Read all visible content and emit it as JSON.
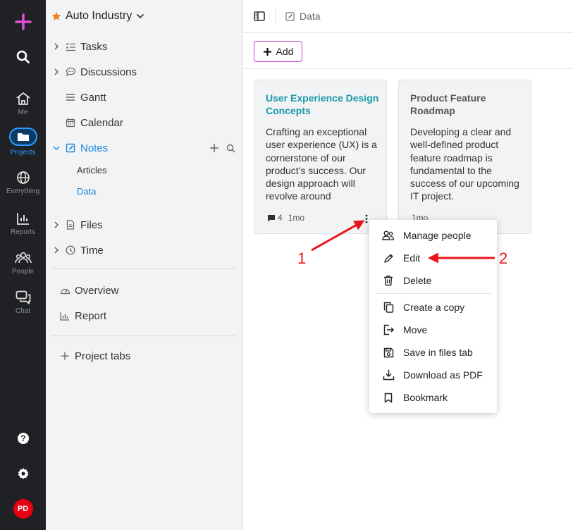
{
  "rail": {
    "items": [
      {
        "icon": "home-icon",
        "label": "Me"
      },
      {
        "icon": "folder-icon",
        "label": "Projects"
      },
      {
        "icon": "globe-icon",
        "label": "Everything"
      },
      {
        "icon": "chart-icon",
        "label": "Reports"
      },
      {
        "icon": "people-icon",
        "label": "People"
      },
      {
        "icon": "chat-icon",
        "label": "Chat"
      }
    ],
    "avatar": "PD",
    "accent": "#2f9bff",
    "add_color": "#e04fd6"
  },
  "sidebar": {
    "project": "Auto Industry",
    "nav": [
      {
        "label": "Tasks"
      },
      {
        "label": "Discussions"
      },
      {
        "label": "Gantt"
      },
      {
        "label": "Calendar"
      },
      {
        "label": "Notes"
      },
      {
        "label": "Files"
      },
      {
        "label": "Time"
      }
    ],
    "notes_sub": [
      {
        "label": "Articles"
      },
      {
        "label": "Data"
      }
    ],
    "extra": [
      {
        "label": "Overview"
      },
      {
        "label": "Report"
      }
    ],
    "project_tabs": "Project tabs"
  },
  "main": {
    "breadcrumb": "Data",
    "add_label": "Add",
    "cards": [
      {
        "title": "User Experience Design Concepts",
        "body": "Crafting an exceptional user experience (UX) is a cornerstone of our product's success. Our design approach will revolve around",
        "comments": "4",
        "age": "1mo",
        "title_color": "#1a9aa8"
      },
      {
        "title": "Product Feature Roadmap",
        "body": "Developing a clear and well-defined product feature roadmap is fundamental to the success of our upcoming IT project.",
        "age": "1mo",
        "title_color": "#555555"
      }
    ]
  },
  "menu": {
    "items": [
      {
        "label": "Manage people",
        "icon": "manage-people-icon"
      },
      {
        "label": "Edit",
        "icon": "pencil-icon"
      },
      {
        "label": "Delete",
        "icon": "trash-icon"
      },
      {
        "label": "Create a copy",
        "icon": "copy-icon"
      },
      {
        "label": "Move",
        "icon": "move-icon"
      },
      {
        "label": "Save in files tab",
        "icon": "save-icon"
      },
      {
        "label": "Download as PDF",
        "icon": "download-icon"
      },
      {
        "label": "Bookmark",
        "icon": "bookmark-icon"
      }
    ]
  },
  "annotations": {
    "arrow1": "1",
    "arrow2": "2",
    "color": "#e8161b"
  }
}
